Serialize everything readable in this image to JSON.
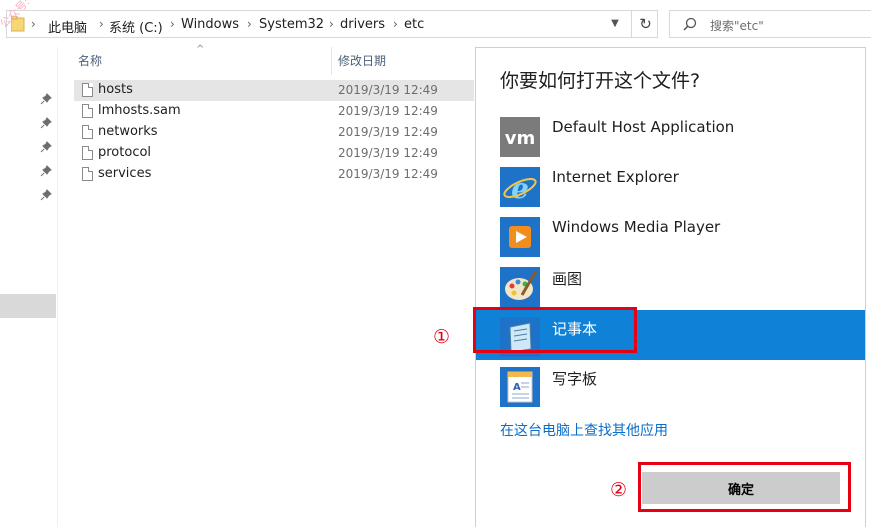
{
  "address_bar": {
    "crumbs": [
      "此电脑",
      "系统 (C:)",
      "Windows",
      "System32",
      "drivers",
      "etc"
    ],
    "search_placeholder": "搜索\"etc\""
  },
  "file_list": {
    "columns": {
      "name": "名称",
      "modified": "修改日期"
    },
    "files": [
      {
        "name": "hosts",
        "modified": "2019/3/19 12:49",
        "selected": true
      },
      {
        "name": "lmhosts.sam",
        "modified": "2019/3/19 12:49",
        "selected": false
      },
      {
        "name": "networks",
        "modified": "2019/3/19 12:49",
        "selected": false
      },
      {
        "name": "protocol",
        "modified": "2019/3/19 12:49",
        "selected": false
      },
      {
        "name": "services",
        "modified": "2019/3/19 12:49",
        "selected": false
      }
    ]
  },
  "open_with_dialog": {
    "title": "你要如何打开这个文件?",
    "apps": [
      {
        "label": "Default Host Application",
        "icon": "vm-icon",
        "selected": false
      },
      {
        "label": "Internet Explorer",
        "icon": "internet-explorer-icon",
        "selected": false
      },
      {
        "label": "Windows Media Player",
        "icon": "media-player-icon",
        "selected": false
      },
      {
        "label": "画图",
        "icon": "paint-icon",
        "selected": false
      },
      {
        "label": "记事本",
        "icon": "notepad-icon",
        "selected": true
      },
      {
        "label": "写字板",
        "icon": "wordpad-icon",
        "selected": false
      }
    ],
    "more_apps_link": "在这台电脑上查找其他应用",
    "ok_button": "确定"
  },
  "annotations": {
    "step1": "①",
    "step2": "②"
  },
  "watermark": "公众号: 软件小帅",
  "colors": {
    "selection_blue": "#0f82d7",
    "annotation_red": "#e60012",
    "link_blue": "#0b6dc9"
  }
}
